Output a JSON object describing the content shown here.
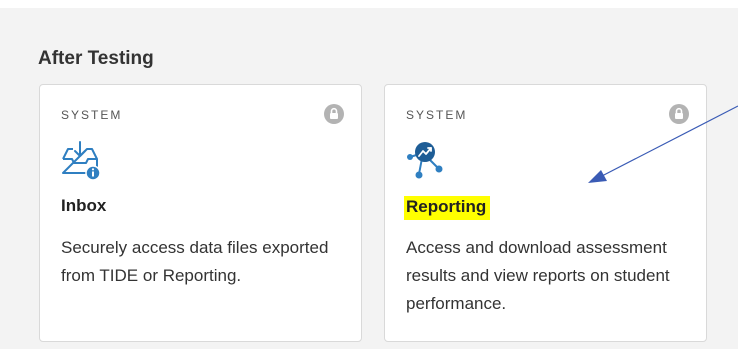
{
  "section": {
    "title": "After Testing"
  },
  "cards": [
    {
      "kicker": "SYSTEM",
      "icon": "inbox-info-icon",
      "title": "Inbox",
      "description": "Securely access data files exported from TIDE or Reporting."
    },
    {
      "kicker": "SYSTEM",
      "icon": "reporting-network-icon",
      "title": "Reporting",
      "description": "Access and download assessment results and view reports on student performance.",
      "highlight_color": "#ffff00"
    }
  ],
  "colors": {
    "brand_blue": "#2f7fc1",
    "lock_gray": "#b3b3b3",
    "arrow_blue": "#3a5bb5"
  }
}
